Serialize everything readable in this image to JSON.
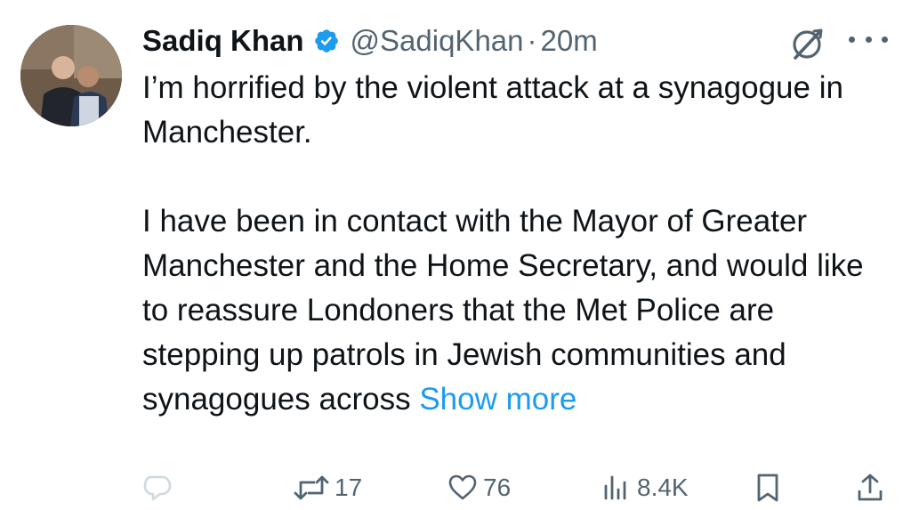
{
  "author": {
    "name": "Sadiq Khan",
    "handle": "@SadiqKhan",
    "separator": "·",
    "time": "20m",
    "verified_icon": "verified-badge-icon",
    "avatar": "profile-photo"
  },
  "tweet": {
    "paragraph1": "I’m horrified by the violent attack at a synagogue in Manchester.",
    "paragraph2": "I have been in contact with the Mayor of Greater Manchester and the Home Secretary, and would like to reassure Londoners that the Met Police are stepping up patrols in Jewish communities and synagogues across",
    "show_more": "Show more"
  },
  "actions": {
    "reply": {
      "icon": "reply-icon",
      "count": ""
    },
    "retweet": {
      "icon": "retweet-icon",
      "count": "17"
    },
    "like": {
      "icon": "heart-icon",
      "count": "76"
    },
    "views": {
      "icon": "views-chart-icon",
      "count": "8.4K"
    },
    "bookmark": {
      "icon": "bookmark-icon"
    },
    "share": {
      "icon": "share-icon"
    }
  },
  "colors": {
    "text": "#0f1419",
    "secondary": "#536471",
    "link": "#1d9bf0",
    "verified": "#1d9bf0",
    "reply_faded": "#cfd9de"
  }
}
